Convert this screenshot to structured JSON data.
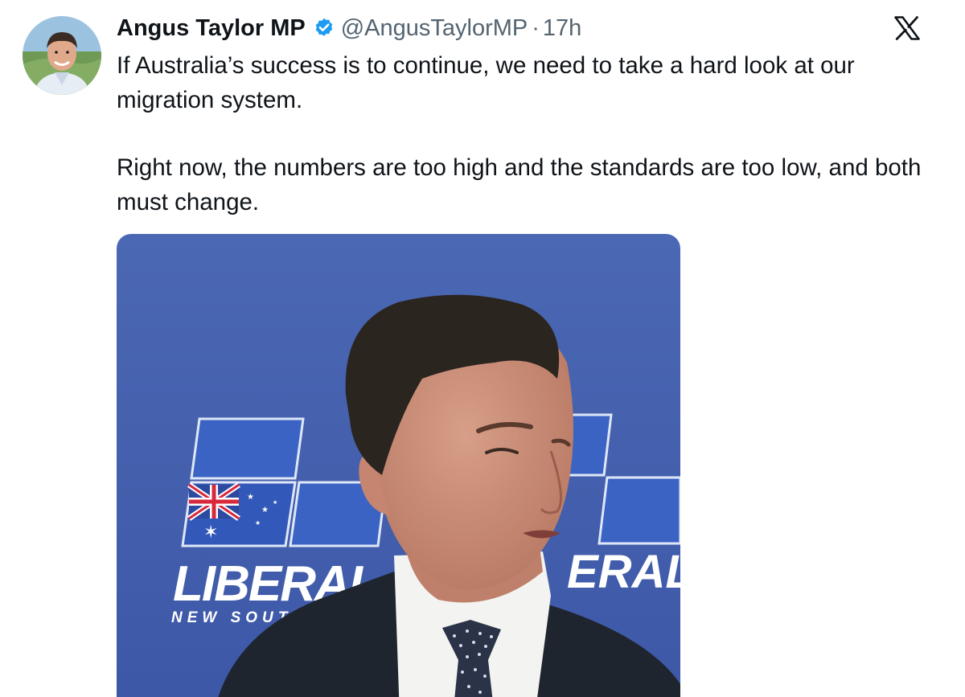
{
  "author": {
    "display_name": "Angus Taylor MP",
    "verified": true,
    "handle": "@AngusTaylorMP",
    "separator": "·",
    "time": "17h",
    "avatar_icon": "profile-avatar"
  },
  "platform": {
    "logo_icon": "x-logo-icon"
  },
  "tweet": {
    "paragraph_1": "If Australia’s success is to continue, we need to take a hard look at our migration system.",
    "paragraph_2": "Right now, the numbers are too high and the standards are too low, and both must change."
  },
  "media": {
    "type": "video-frame",
    "backdrop_text": "LIBERAL",
    "backdrop_subtext": "NEW SOUTH W",
    "backdrop_text_right": "ERAL"
  },
  "colors": {
    "verified_blue": "#1d9bf0",
    "text_primary": "#0f1419",
    "text_secondary": "#536471",
    "backdrop_blue": "#3f5fae"
  }
}
